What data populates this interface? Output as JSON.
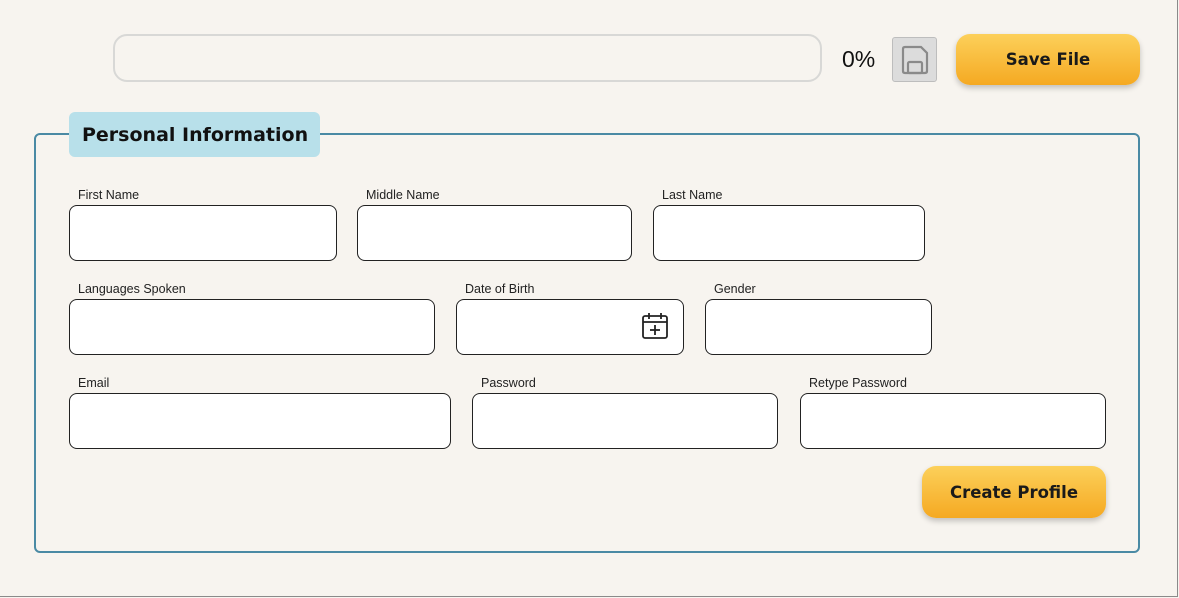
{
  "toolbar": {
    "progress_percent": 0,
    "progress_text": "0%",
    "save_icon": "floppy-disk-icon",
    "save_file_label": "Save File"
  },
  "form": {
    "legend": "Personal Information",
    "fields": {
      "first_name": {
        "label": "First Name",
        "value": ""
      },
      "middle_name": {
        "label": "Middle Name",
        "value": ""
      },
      "last_name": {
        "label": "Last Name",
        "value": ""
      },
      "languages_spoken": {
        "label": "Languages Spoken",
        "value": ""
      },
      "date_of_birth": {
        "label": "Date of Birth",
        "value": "",
        "icon": "calendar-add-icon"
      },
      "gender": {
        "label": "Gender",
        "value": ""
      },
      "email": {
        "label": "Email",
        "value": ""
      },
      "password": {
        "label": "Password",
        "value": ""
      },
      "retype_password": {
        "label": "Retype Password",
        "value": ""
      }
    },
    "create_profile_label": "Create Profile"
  },
  "colors": {
    "background": "#f7f4ef",
    "accent_yellow": "#f5a922",
    "fieldset_border": "#4a8aa4",
    "legend_bg": "#b8e0ea"
  }
}
